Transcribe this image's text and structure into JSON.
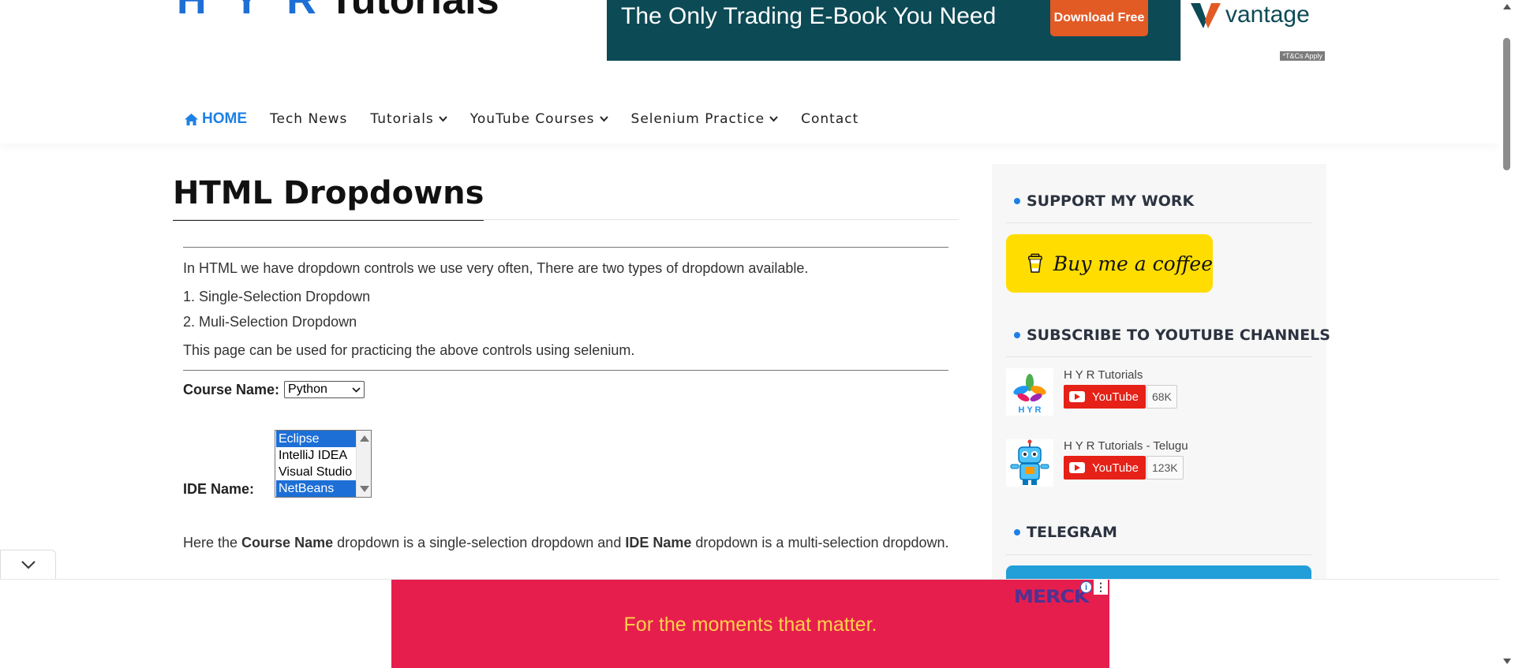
{
  "header": {
    "logo_hyr": "H Y R",
    "logo_tutorials": "Tutorials"
  },
  "top_ad": {
    "headline": "The Only Trading E-Book You Need",
    "button": "Download Free",
    "brand": "vantage",
    "terms": "*T&Cs Apply",
    "colors": {
      "background": "#0c4a55",
      "button": "#e25a24"
    }
  },
  "nav": {
    "items": [
      {
        "label": "HOME",
        "active": true,
        "icon": "home-icon"
      },
      {
        "label": "Tech News"
      },
      {
        "label": "Tutorials",
        "dropdown": true
      },
      {
        "label": "YouTube Courses",
        "dropdown": true
      },
      {
        "label": "Selenium Practice",
        "dropdown": true
      },
      {
        "label": "Contact"
      }
    ]
  },
  "main": {
    "title": "HTML Dropdowns",
    "intro": "In HTML we have dropdown controls we use very often, There are two types of dropdown available.",
    "list_item_1": "1. Single-Selection Dropdown",
    "list_item_2": "2. Muli-Selection Dropdown",
    "practice_note": "This page can be used for practicing the above controls using selenium.",
    "course_label": "Course Name:",
    "course_selected": "Python",
    "ide_label": "IDE Name:",
    "ide_options": [
      {
        "label": "Eclipse",
        "selected": true
      },
      {
        "label": "IntelliJ IDEA",
        "selected": false
      },
      {
        "label": "Visual Studio",
        "selected": false
      },
      {
        "label": "NetBeans",
        "selected": true
      }
    ],
    "explanation": {
      "part1": "Here the ",
      "bold1": "Course Name",
      "part2": " dropdown is a single-selection dropdown and ",
      "bold2": "IDE Name",
      "part3": " dropdown is a multi-selection dropdown."
    }
  },
  "sidebar": {
    "support_title": "SUPPORT MY WORK",
    "coffee_label": "Buy me a coffee",
    "subscribe_title": "SUBSCRIBE TO YOUTUBE CHANNELS",
    "channels": [
      {
        "name": "H Y R Tutorials",
        "button": "YouTube",
        "count": "68K"
      },
      {
        "name": "H Y R Tutorials - Telugu",
        "button": "YouTube",
        "count": "123K"
      }
    ],
    "telegram_title": "TELEGRAM"
  },
  "bottom_ad": {
    "slogan": "For the moments that matter.",
    "brand": "MERCK",
    "info_glyph": "i",
    "menu_glyph": "⋮",
    "colors": {
      "background": "#e61e4d",
      "slogan": "#ffd24a",
      "brand": "#503291"
    }
  },
  "colors": {
    "accent": "#1d80e6",
    "youtube": "#e62117",
    "coffee": "#ffdd00",
    "telegram": "#229ed9"
  }
}
